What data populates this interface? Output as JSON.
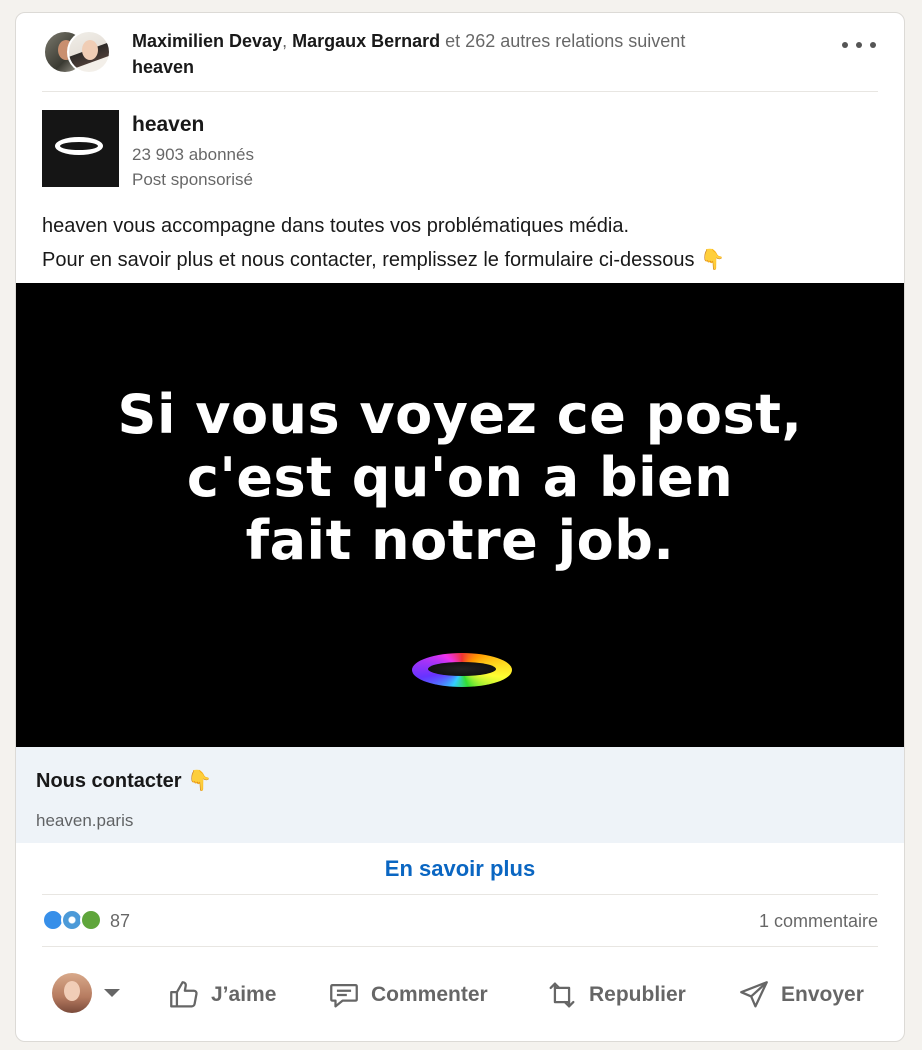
{
  "social": {
    "name1": "Maximilien Devay",
    "sep": ",",
    "name2": "Margaux Bernard",
    "rest": "et 262 autres relations suivent",
    "company": "heaven"
  },
  "actor": {
    "name": "heaven",
    "followers": "23 903 abonnés",
    "sponsored": "Post sponsorisé"
  },
  "post": {
    "line1": "heaven vous accompagne dans toutes vos problématiques média.",
    "line2": "Pour en savoir plus et nous contacter, remplissez le formulaire ci-dessous 👇"
  },
  "media": {
    "headline_line1": "Si vous voyez ce post,",
    "headline_line2": "c'est qu'on a bien",
    "headline_line3": "fait notre job."
  },
  "cta": {
    "title": "Nous contacter 👇",
    "domain": "heaven.paris",
    "button_label": "En savoir plus",
    "button_color": "#0a66c2"
  },
  "counts": {
    "reactions": "87",
    "comments": "1 commentaire"
  },
  "actions": {
    "like": "J’aime",
    "comment": "Commenter",
    "repost": "Republier",
    "send": "Envoyer"
  },
  "icons": [
    "more-icon",
    "like-icon",
    "comment-icon",
    "repost-icon",
    "send-icon",
    "caret-down-icon"
  ]
}
